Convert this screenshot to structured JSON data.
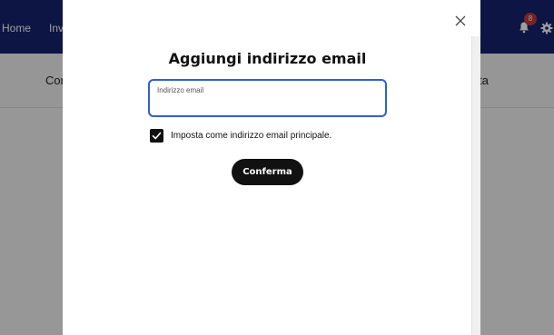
{
  "background": {
    "nav": {
      "home": "Home",
      "inv": "Inv"
    },
    "notifications": {
      "badge_count": "8"
    },
    "subbar": {
      "left_text": "Cor",
      "right_text": "ta"
    }
  },
  "modal": {
    "title": "Aggiungi indirizzo email",
    "email_field": {
      "label": "Indirizzo email",
      "value": ""
    },
    "primary_checkbox": {
      "checked": true,
      "label": "Imposta come indirizzo email principale."
    },
    "confirm_label": "Conferma"
  },
  "colors": {
    "topbar": "#14226c",
    "badge": "#c1393a",
    "focus_border": "#2f5fd1",
    "button": "#111111"
  },
  "icons": [
    "bell-icon",
    "gear-icon",
    "close-icon",
    "checkmark-icon"
  ]
}
